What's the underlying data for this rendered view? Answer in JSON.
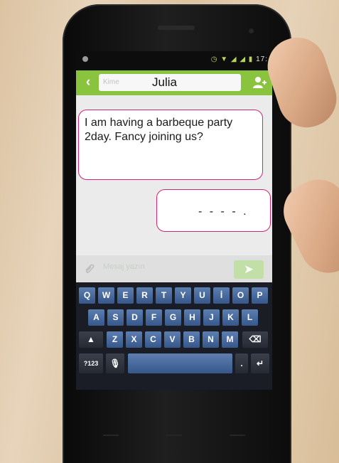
{
  "status_bar": {
    "icons": "◷ ▼ ◢ ◢ ▮",
    "time": "17:"
  },
  "header": {
    "back_icon": "chevron-left-icon",
    "recipient_placeholder": "Kime",
    "recipient_name": "Julia",
    "add_contact_icon": "add-contact-icon"
  },
  "messages": [
    {
      "direction": "incoming",
      "text": "I am having a barbeque party 2day. Fancy joining us?"
    },
    {
      "direction": "outgoing",
      "text": "- - - - ."
    }
  ],
  "compose": {
    "placeholder": "Mesaj yazın",
    "send_icon": "send-icon"
  },
  "keyboard": {
    "row1": [
      "Q",
      "W",
      "E",
      "R",
      "T",
      "Y",
      "U",
      "İ",
      "O",
      "P"
    ],
    "row2": [
      "A",
      "S",
      "D",
      "F",
      "G",
      "H",
      "J",
      "K",
      "L"
    ],
    "row3": [
      "Z",
      "X",
      "C",
      "V",
      "B",
      "N",
      "M"
    ],
    "symbols_label": "?123",
    "period_label": ".",
    "shift_icon": "shift-icon",
    "backspace_icon": "backspace-icon",
    "mic_icon": "mic-icon",
    "enter_icon": "enter-icon"
  },
  "colors": {
    "accent_green": "#8ac43f",
    "bubble_border": "#d0257b",
    "key_blue": "#4a6da0"
  }
}
